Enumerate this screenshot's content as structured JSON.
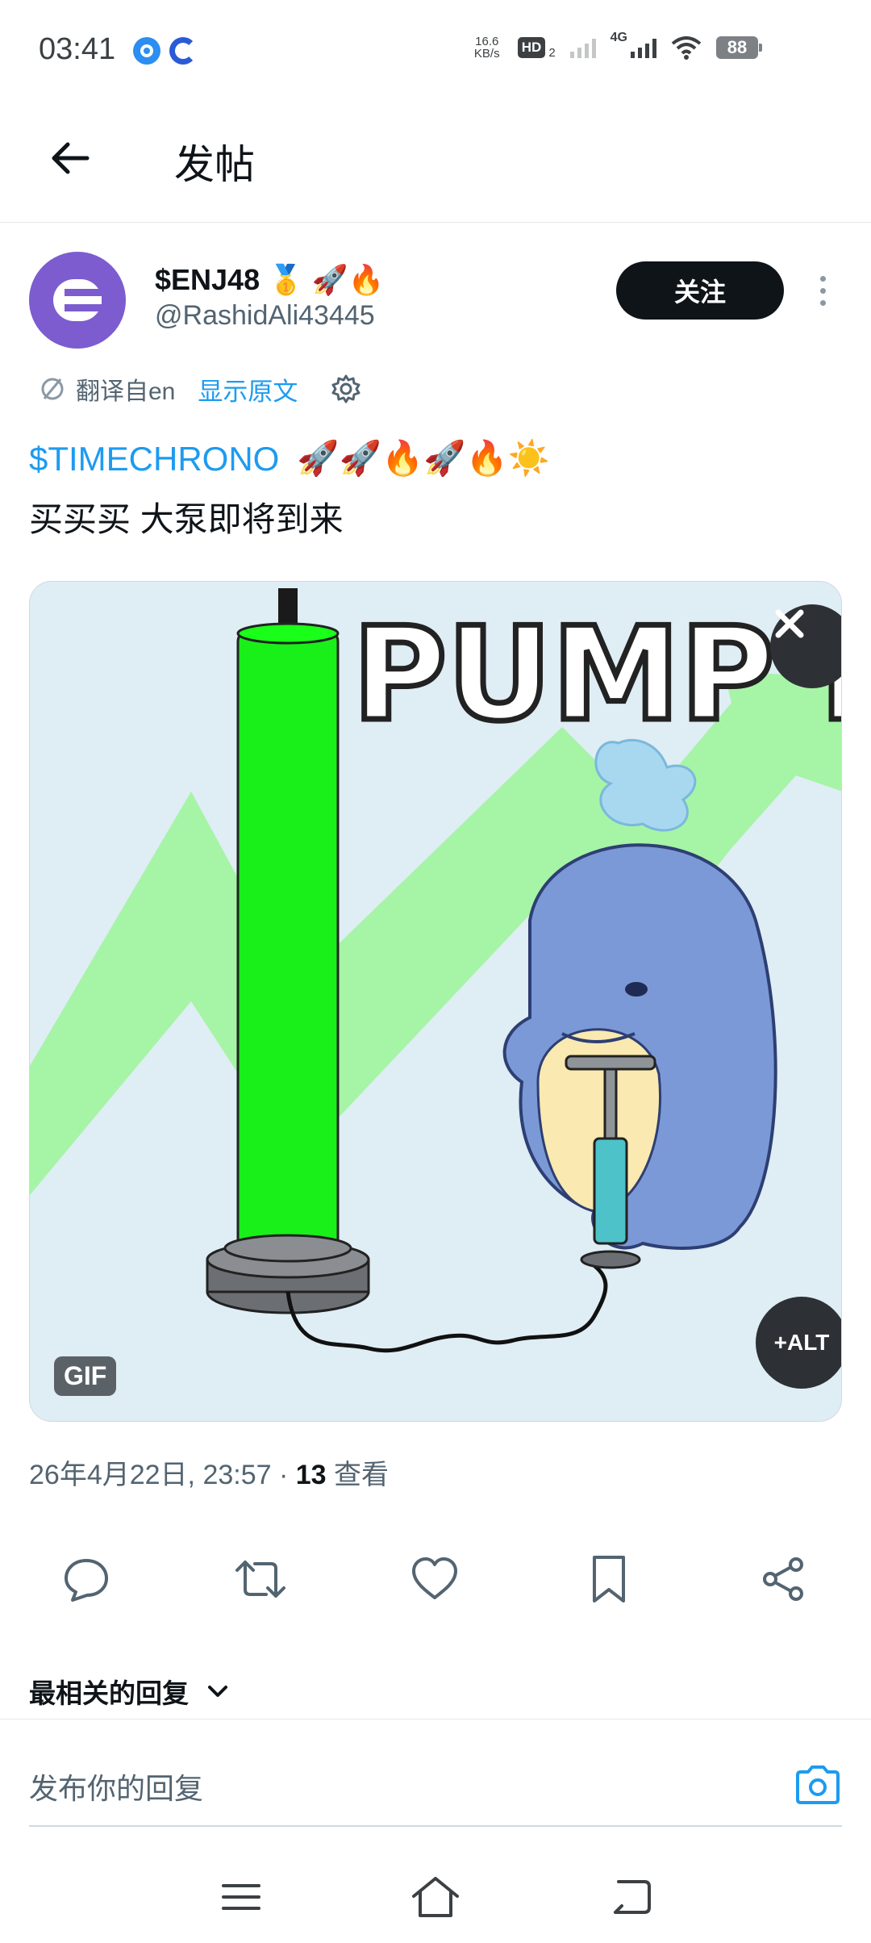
{
  "status_bar": {
    "time": "03:41",
    "net_speed_value": "16.6",
    "net_speed_unit": "KB/s",
    "hd_label": "HD",
    "hd_sub": "2",
    "network_type": "4G",
    "battery": "88",
    "icons": [
      "app-icon-1",
      "app-icon-2",
      "signal-icon",
      "wifi-icon",
      "battery-icon"
    ]
  },
  "header": {
    "back_icon": "arrow-left-icon",
    "title": "发帖"
  },
  "author": {
    "avatar_letter": "E",
    "name": "$ENJ48 🥇 🚀🔥",
    "handle": "@RashidAli43445",
    "follow_label": "关注"
  },
  "translation": {
    "translated_from": "翻译自en",
    "show_original": "显示原文"
  },
  "post": {
    "cashtag": "$TIMECHRONO",
    "emojis": "🚀🚀🔥🚀🔥☀️",
    "text": "买买买 大泵即将到来"
  },
  "media": {
    "gif_text": "PUMP IT",
    "gif_badge": "GIF",
    "alt_label": "+ALT",
    "colors": {
      "background": "#dfedf4",
      "arrow": "#a6f4a6",
      "tube": "#19f019",
      "whale": "#7b99d6",
      "belly": "#fae9b0"
    }
  },
  "meta": {
    "datetime": "26年4月22日, 23:57 · ",
    "views_count": "13",
    "views_label": " 查看"
  },
  "actions": [
    "reply-icon",
    "retweet-icon",
    "like-icon",
    "bookmark-icon",
    "share-icon"
  ],
  "replies": {
    "filter_label": "最相关的回复"
  },
  "reply_bar": {
    "placeholder": "发布你的回复"
  },
  "colors": {
    "accent": "#1d9bf0",
    "text": "#0f1419",
    "secondary": "#536471"
  }
}
